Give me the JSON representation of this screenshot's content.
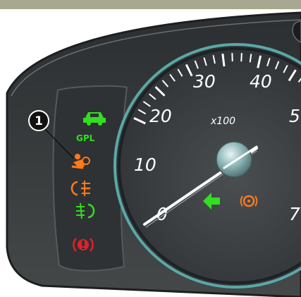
{
  "callout": {
    "number": "1"
  },
  "gauge": {
    "multiplier": "x100",
    "scale_labels": [
      "0",
      "10",
      "20",
      "30",
      "40",
      "5",
      "7"
    ],
    "needle_reading": 0
  },
  "warning_lights": {
    "gpl_label": "GPL",
    "items": [
      {
        "icon": "vehicle-icon",
        "color": "#33dd22"
      },
      {
        "icon": "gpl-icon",
        "color": "#33dd22"
      },
      {
        "icon": "airbag-warning-icon",
        "color": "#ff7a1a"
      },
      {
        "icon": "rear-fog-light-icon",
        "color": "#ff7a1a"
      },
      {
        "icon": "front-fog-light-icon",
        "color": "#33dd22"
      },
      {
        "icon": "brake-warning-icon",
        "color": "#e0202a"
      }
    ],
    "center_indicators": [
      {
        "icon": "left-turn-arrow-icon",
        "color": "#33dd22"
      },
      {
        "icon": "esp-warning-icon",
        "color": "#ff7a1a"
      }
    ]
  },
  "colors": {
    "top_band": "#a8a890",
    "panel": "#3c3f41",
    "bezel": "#2a2d2f",
    "chrome_ring": "#5aa8a8"
  }
}
